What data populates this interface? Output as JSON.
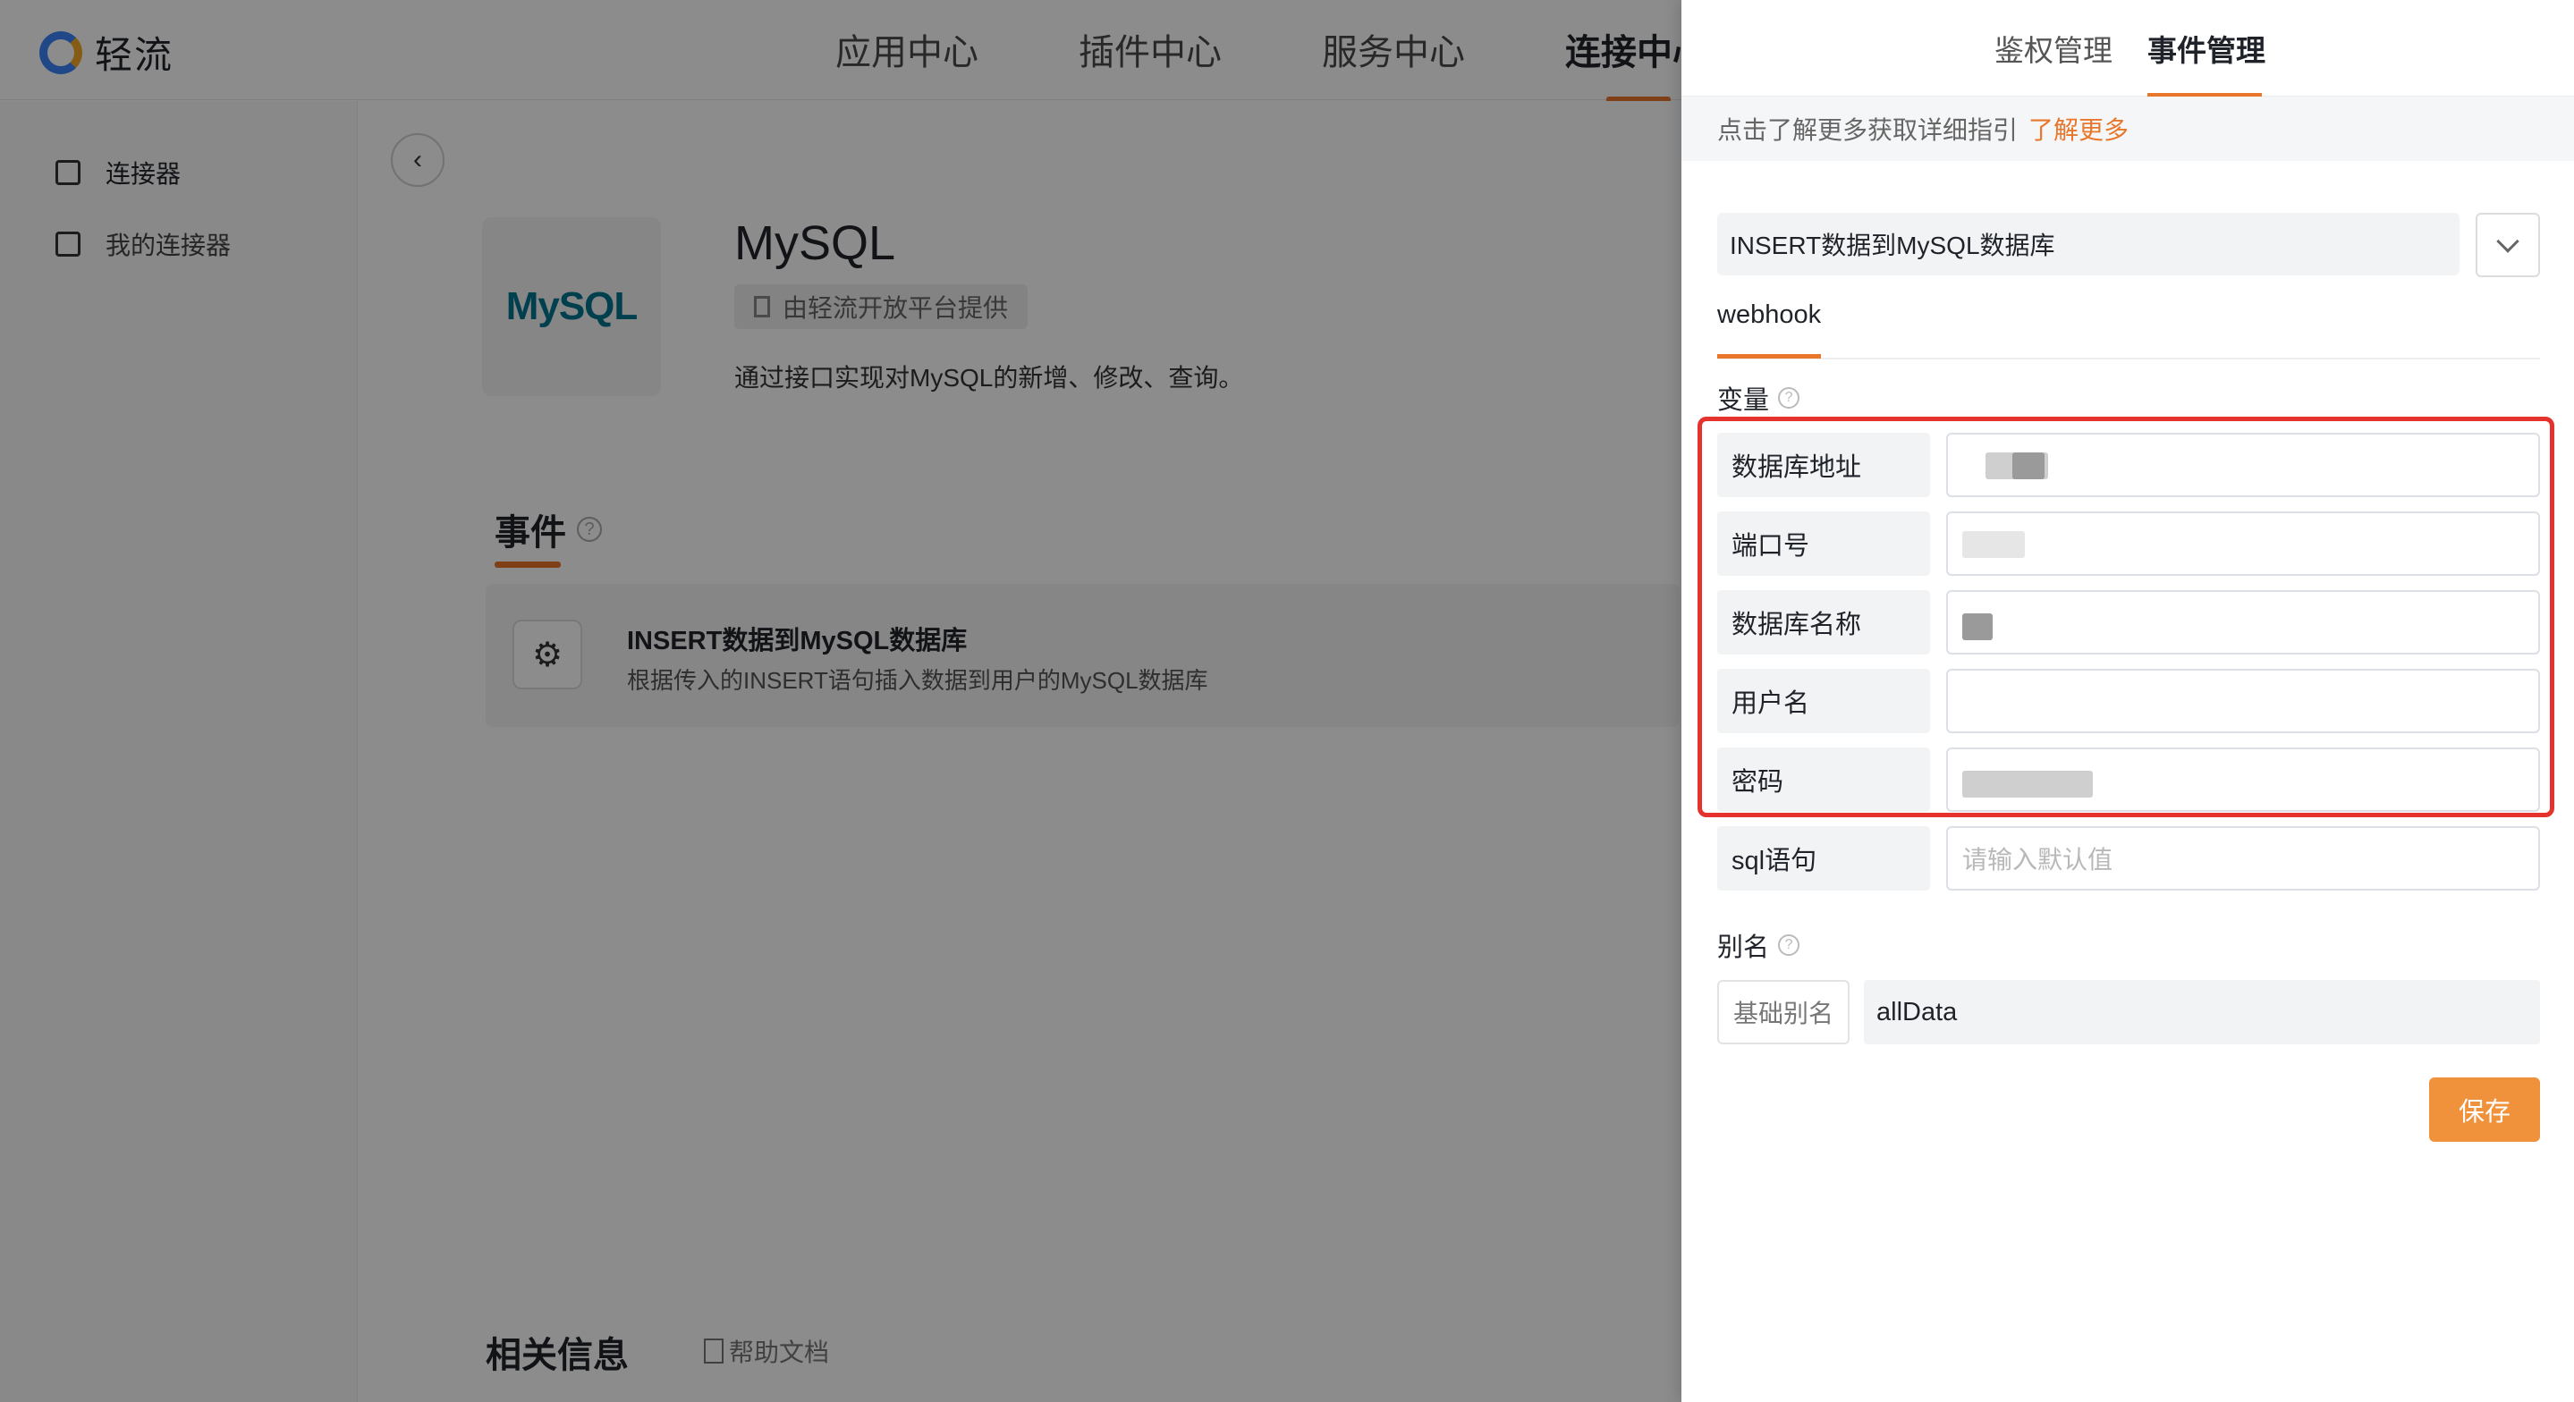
{
  "app": {
    "logo_text": "轻流",
    "nav": [
      {
        "label": "应用中心"
      },
      {
        "label": "插件中心"
      },
      {
        "label": "服务中心"
      },
      {
        "label": "连接中心"
      }
    ],
    "accent_color": "#e8762b"
  },
  "sidebar": {
    "items": [
      {
        "label": "连接器",
        "icon": "connector-icon"
      },
      {
        "label": "我的连接器",
        "icon": "download-box-icon"
      }
    ]
  },
  "connector": {
    "logo_text": "MySQL",
    "title": "MySQL",
    "provider": "由轻流开放平台提供",
    "description": "通过接口实现对MySQL的新增、修改、查询。",
    "events_title": "事件",
    "event": {
      "name": "INSERT数据到MySQL数据库",
      "description": "根据传入的INSERT语句插入数据到用户的MySQL数据库"
    },
    "related_title": "相关信息",
    "help_doc": "帮助文档"
  },
  "drawer": {
    "tabs": [
      {
        "label": "鉴权管理"
      },
      {
        "label": "事件管理"
      }
    ],
    "guide_text": "点击了解更多获取详细指引",
    "guide_link": "了解更多",
    "selected_event": "INSERT数据到MySQL数据库",
    "subtab": "webhook",
    "variables_label": "变量",
    "variables": [
      {
        "label": "数据库地址",
        "value": ""
      },
      {
        "label": "端口号",
        "value": ""
      },
      {
        "label": "数据库名称",
        "value": ""
      },
      {
        "label": "用户名",
        "value": ""
      },
      {
        "label": "密码",
        "value": ""
      },
      {
        "label": "sql语句",
        "value": "",
        "placeholder": "请输入默认值"
      }
    ],
    "alias_label": "别名",
    "alias_prefix": "基础别名",
    "alias_value": "allData",
    "save_label": "保存",
    "highlight_color": "#e5322d"
  }
}
